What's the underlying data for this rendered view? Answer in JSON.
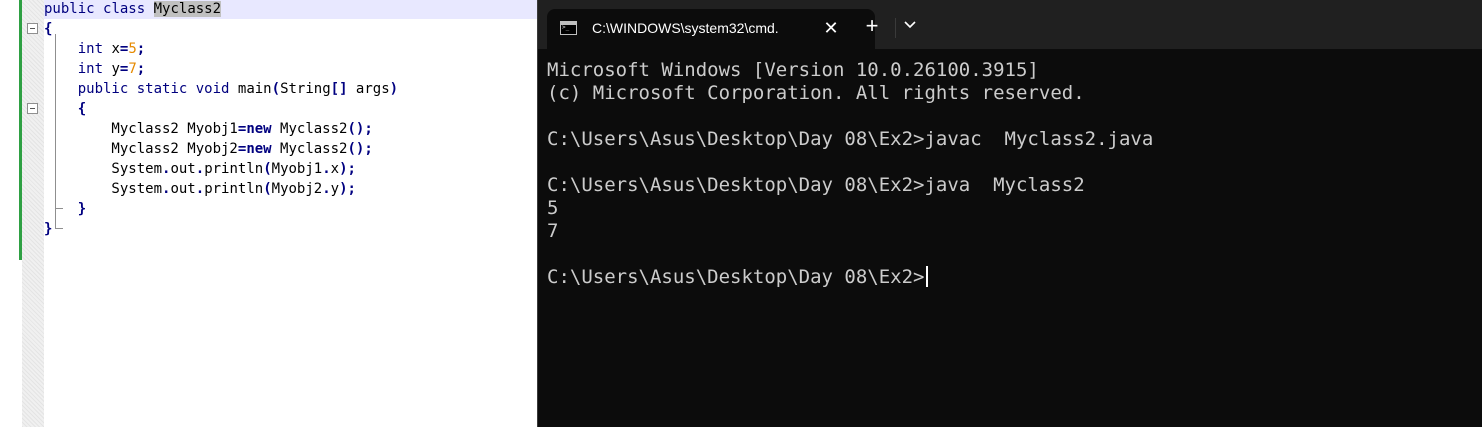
{
  "editor": {
    "lines": [
      [
        {
          "t": "public",
          "c": "kw"
        },
        {
          "t": " "
        },
        {
          "t": "class",
          "c": "kw"
        },
        {
          "t": " "
        },
        {
          "t": "Myclass2",
          "c": "sel"
        }
      ],
      [
        {
          "t": "{",
          "c": "op"
        }
      ],
      [
        {
          "t": "    "
        },
        {
          "t": "int",
          "c": "kw"
        },
        {
          "t": " x"
        },
        {
          "t": "=",
          "c": "op"
        },
        {
          "t": "5",
          "c": "num"
        },
        {
          "t": ";",
          "c": "op"
        }
      ],
      [
        {
          "t": "    "
        },
        {
          "t": "int",
          "c": "kw"
        },
        {
          "t": " y"
        },
        {
          "t": "=",
          "c": "op"
        },
        {
          "t": "7",
          "c": "num"
        },
        {
          "t": ";",
          "c": "op"
        }
      ],
      [
        {
          "t": "    "
        },
        {
          "t": "public",
          "c": "kw"
        },
        {
          "t": " "
        },
        {
          "t": "static",
          "c": "kw"
        },
        {
          "t": " "
        },
        {
          "t": "void",
          "c": "kw"
        },
        {
          "t": " main"
        },
        {
          "t": "(",
          "c": "op"
        },
        {
          "t": "String"
        },
        {
          "t": "[]",
          "c": "op"
        },
        {
          "t": " args"
        },
        {
          "t": ")",
          "c": "op"
        }
      ],
      [
        {
          "t": "    "
        },
        {
          "t": "{",
          "c": "op"
        }
      ],
      [
        {
          "t": "        Myclass2 Myobj1"
        },
        {
          "t": "=",
          "c": "op"
        },
        {
          "t": "new",
          "c": "kwb"
        },
        {
          "t": " Myclass2"
        },
        {
          "t": "();",
          "c": "op"
        }
      ],
      [
        {
          "t": "        Myclass2 Myobj2"
        },
        {
          "t": "=",
          "c": "op"
        },
        {
          "t": "new",
          "c": "kwb"
        },
        {
          "t": " Myclass2"
        },
        {
          "t": "();",
          "c": "op"
        }
      ],
      [
        {
          "t": "        System"
        },
        {
          "t": ".",
          "c": "op"
        },
        {
          "t": "out"
        },
        {
          "t": ".",
          "c": "op"
        },
        {
          "t": "println"
        },
        {
          "t": "(",
          "c": "op"
        },
        {
          "t": "Myobj1"
        },
        {
          "t": ".",
          "c": "op"
        },
        {
          "t": "x"
        },
        {
          "t": ");",
          "c": "op"
        }
      ],
      [
        {
          "t": "        System"
        },
        {
          "t": ".",
          "c": "op"
        },
        {
          "t": "out"
        },
        {
          "t": ".",
          "c": "op"
        },
        {
          "t": "println"
        },
        {
          "t": "(",
          "c": "op"
        },
        {
          "t": "Myobj2"
        },
        {
          "t": ".",
          "c": "op"
        },
        {
          "t": "y"
        },
        {
          "t": ");",
          "c": "op"
        }
      ],
      [
        {
          "t": "    "
        },
        {
          "t": "}",
          "c": "op"
        }
      ],
      [
        {
          "t": "}",
          "c": "op"
        }
      ]
    ]
  },
  "terminal": {
    "tab_title": "C:\\WINDOWS\\system32\\cmd.",
    "tab_icon": "cmd-icon",
    "close_glyph": "✕",
    "new_tab_glyph": "+",
    "dropdown_icon": "chevron-down-icon",
    "lines": [
      "Microsoft Windows [Version 10.0.26100.3915]",
      "(c) Microsoft Corporation. All rights reserved.",
      "",
      "C:\\Users\\Asus\\Desktop\\Day 08\\Ex2>javac  Myclass2.java",
      "",
      "C:\\Users\\Asus\\Desktop\\Day 08\\Ex2>java  Myclass2",
      "5",
      "7",
      "",
      "C:\\Users\\Asus\\Desktop\\Day 08\\Ex2>"
    ]
  },
  "colors": {
    "terminal_bg": "#0c0c0c",
    "tabbar_bg": "#202020",
    "terminal_text": "#cccccc",
    "keyword": "#00007f",
    "number": "#e68a00",
    "change_bar": "#2ea043",
    "current_line": "#e8e8ff"
  }
}
